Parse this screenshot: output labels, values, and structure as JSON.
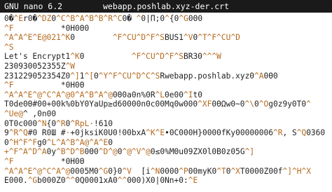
{
  "header": {
    "version": "GNU nano 6.2",
    "filename": "webapp.poshlab.xyz-der.crt"
  },
  "lines": [
    [
      [
        "t",
        "0�"
      ],
      [
        "c",
        "^E"
      ],
      [
        "t",
        "r0�"
      ],
      [
        "c",
        "^DZ"
      ],
      [
        "t",
        "0"
      ],
      [
        "c",
        "^C^B^A^B^B^R^C"
      ],
      [
        "t",
        "0� "
      ],
      [
        "c",
        "^"
      ],
      [
        "t",
        "0|Π;"
      ],
      [
        "t",
        "0"
      ],
      [
        "c",
        "^"
      ],
      [
        "t",
        "{0"
      ],
      [
        "c",
        "^G"
      ],
      [
        "t",
        "0Θ0"
      ]
    ],
    [
      [
        "c",
        "^F"
      ],
      [
        "t",
        "          *0Η0Θ0"
      ]
    ],
    [
      [
        "c",
        "^A^A^E^E@021^K"
      ],
      [
        "t",
        "0        "
      ],
      [
        "c",
        "^F^CU^D^F^S"
      ],
      [
        "t",
        "BUS1"
      ],
      [
        "c",
        "^V"
      ],
      [
        "t",
        "0"
      ],
      [
        "c",
        "^T^F^CU^D"
      ]
    ],
    [
      [
        "c",
        "^S"
      ]
    ],
    [
      [
        "t",
        "Let's Encrypt1"
      ],
      [
        "c",
        "^K"
      ],
      [
        "t",
        "0          "
      ],
      [
        "c",
        "^F^CU^D^F^S"
      ],
      [
        "t",
        "BR30"
      ],
      [
        "c",
        "^^^W"
      ]
    ],
    [
      [
        "t",
        "230930052355Z"
      ],
      [
        "c",
        "^W"
      ]
    ],
    [
      [
        "t",
        "231229052354Z0"
      ],
      [
        "c",
        "^]"
      ],
      [
        "t",
        "1"
      ],
      [
        "c",
        "^["
      ],
      [
        "t",
        "0"
      ],
      [
        "c",
        "^Y^F^CU^D^C^S"
      ],
      [
        "t",
        "Rwebapp.poshlab.xyz0"
      ],
      [
        "c",
        "^A"
      ],
      [
        "t",
        "0Θ0"
      ]
    ],
    [
      [
        "c",
        "^F"
      ],
      [
        "t",
        "          *0Η0Θ"
      ]
    ],
    [
      [
        "c",
        "^A^A^E^@^C^A^@0"
      ],
      [
        "c",
        "^A^B^A^@"
      ],
      [
        "t",
        "0Θ0a0n%0R"
      ],
      [
        "c",
        "^L"
      ],
      [
        "t",
        "0e00"
      ],
      [
        "c",
        "^I"
      ],
      [
        "t",
        "t0"
      ]
    ],
    [
      [
        "t",
        "T0de0Θ#00+00k%0bY0YaUp≥d60000n0c00Mq0w000"
      ],
      [
        "c",
        "^XF"
      ],
      [
        "t",
        "0ΘΩw0~0"
      ],
      [
        "c",
        "^\\"
      ],
      [
        "t",
        "0"
      ],
      [
        "c",
        "^O"
      ],
      [
        "t",
        "g0z9y0T0"
      ],
      [
        "c",
        "^"
      ]
    ],
    [
      [
        "c",
        "^Ue@"
      ],
      [
        "t",
        "^ ,0n00"
      ]
    ],
    [
      [
        "t",
        "0T0c000"
      ],
      [
        "c",
        "^N"
      ],
      [
        "t",
        "{0"
      ],
      [
        "c",
        "^R"
      ],
      [
        "t",
        "0"
      ],
      [
        "c",
        "^RpL·"
      ],
      [
        "t",
        "!610"
      ]
    ],
    [
      [
        "t",
        "9"
      ],
      [
        "c",
        "^R^Q"
      ],
      [
        "t",
        "#0 R0Ш #"
      ],
      [
        "c",
        "·"
      ],
      [
        "t",
        "+0jksiK0U0!00bxA"
      ],
      [
        "c",
        "^K^E"
      ],
      [
        "t",
        "•0C000H}0000fKy00000006"
      ],
      [
        "c",
        "^R"
      ],
      [
        "t",
        ", S"
      ],
      [
        "c",
        "^Q"
      ],
      [
        "t",
        "0360"
      ]
    ],
    [
      [
        "t",
        "0"
      ],
      [
        "c",
        "^H^F^F"
      ],
      [
        "t",
        "g0"
      ],
      [
        "c",
        "^L^A^B^A@^A^E"
      ],
      [
        "t",
        "0"
      ]
    ],
    [
      [
        "c",
        "+^F^A^D^A"
      ],
      [
        "t",
        "0y"
      ],
      [
        "c",
        "^B^D^B"
      ],
      [
        "t",
        "0Θ0"
      ],
      [
        "c",
        "^D^@"
      ],
      [
        "t",
        "0"
      ],
      [
        "c",
        "^@^V^@"
      ],
      [
        "t",
        "0≤0%ΜΘu09ZX0l0B0z05G"
      ],
      [
        "c",
        "^]"
      ]
    ],
    [
      [
        "c",
        "^F"
      ],
      [
        "t",
        "          *0Η0Θ"
      ]
    ],
    [
      [
        "c",
        "^A^A^E^@^C^A^@"
      ],
      [
        "t",
        "0005M0"
      ],
      [
        "c",
        "^G"
      ],
      [
        "t",
        "0}0"
      ],
      [
        "c",
        "^V"
      ],
      [
        "t",
        "  [i"
      ],
      [
        "c",
        "^N"
      ],
      [
        "t",
        "0000"
      ],
      [
        "c",
        "^P"
      ],
      [
        "t",
        "00myK0"
      ],
      [
        "c",
        "^T"
      ],
      [
        "t",
        "0"
      ],
      [
        "c",
        "^X"
      ],
      [
        "t",
        "T0000Z00f"
      ],
      [
        "c",
        "^]^H^X"
      ]
    ],
    [
      [
        "t",
        "E000."
      ],
      [
        "c",
        "^G"
      ],
      [
        "t",
        "b000Z0"
      ],
      [
        "c",
        "^^"
      ],
      [
        "t",
        "0Q0001xA0"
      ],
      [
        "c",
        "^^"
      ],
      [
        "t",
        "000)X0|0Nn+0:"
      ],
      [
        "c",
        "^E"
      ]
    ]
  ]
}
